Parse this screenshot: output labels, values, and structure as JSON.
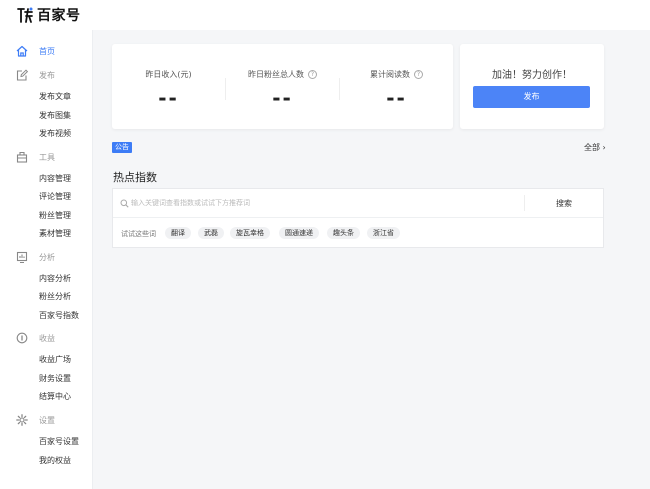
{
  "brand": {
    "name": "百家号"
  },
  "sidebar": {
    "home": {
      "label": "首页"
    },
    "groups": [
      {
        "label": "发布",
        "icon": "edit-icon",
        "items": [
          "发布文章",
          "发布图集",
          "发布视频"
        ]
      },
      {
        "label": "工具",
        "icon": "toolbox-icon",
        "items": [
          "内容管理",
          "评论管理",
          "粉丝管理",
          "素材管理"
        ]
      },
      {
        "label": "分析",
        "icon": "chart-icon",
        "items": [
          "内容分析",
          "粉丝分析",
          "百家号指数"
        ]
      },
      {
        "label": "收益",
        "icon": "coin-icon",
        "items": [
          "收益广场",
          "财务设置",
          "结算中心"
        ]
      },
      {
        "label": "设置",
        "icon": "gear-icon",
        "items": [
          "百家号设置",
          "我的权益"
        ]
      }
    ]
  },
  "stats": [
    {
      "title": "昨日收入(元)",
      "value": "--",
      "help": false
    },
    {
      "title": "昨日粉丝总人数",
      "value": "--",
      "help": true
    },
    {
      "title": "累计阅读数",
      "value": "--",
      "help": true
    }
  ],
  "publish": {
    "slogan": "加油！努力创作！",
    "button": "发布"
  },
  "notice": {
    "tag": "公告",
    "all_link": "全部 ›"
  },
  "hot": {
    "title": "热点指数",
    "search_placeholder": "输入关键词查看指数或试试下方推荐词",
    "search_button": "搜索",
    "try_label": "试试这些词",
    "chips": [
      "翻译",
      "武磊",
      "旋瓦幸格",
      "圆通速递",
      "趣头条",
      "浙江省"
    ]
  },
  "colors": {
    "accent": "#3d7cf6",
    "button": "#4c84f7"
  }
}
